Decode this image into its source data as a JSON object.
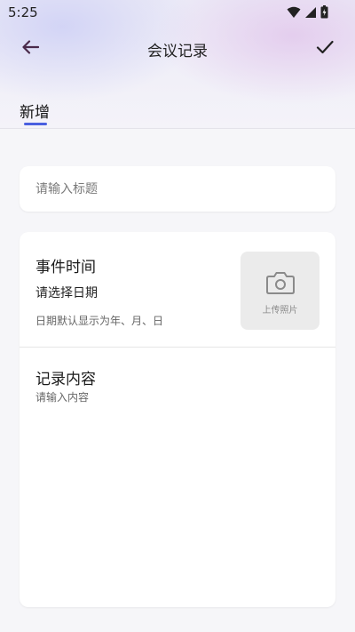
{
  "status_bar": {
    "time": "5:25",
    "icons": [
      "wifi-icon",
      "cellular-signal-icon",
      "battery-icon"
    ]
  },
  "appbar": {
    "title": "会议记录",
    "back_icon": "arrow-left-icon",
    "confirm_icon": "checkmark-icon"
  },
  "tabs": [
    {
      "label": "新增",
      "active": true
    }
  ],
  "form": {
    "title_placeholder": "请输入标题",
    "event_heading": "事件时间",
    "date_picker_label": "请选择日期",
    "date_hint": "日期默认显示为年、月、日",
    "upload_label": "上传照片",
    "upload_icon": "camera-icon",
    "content_heading": "记录内容",
    "content_placeholder": "请输入内容"
  },
  "colors": {
    "accent": "#4a5fe0",
    "back_arrow": "#4a2a4a",
    "page_background": "#f6f6f9",
    "card_background": "#ffffff",
    "upload_background": "#ebebeb"
  }
}
